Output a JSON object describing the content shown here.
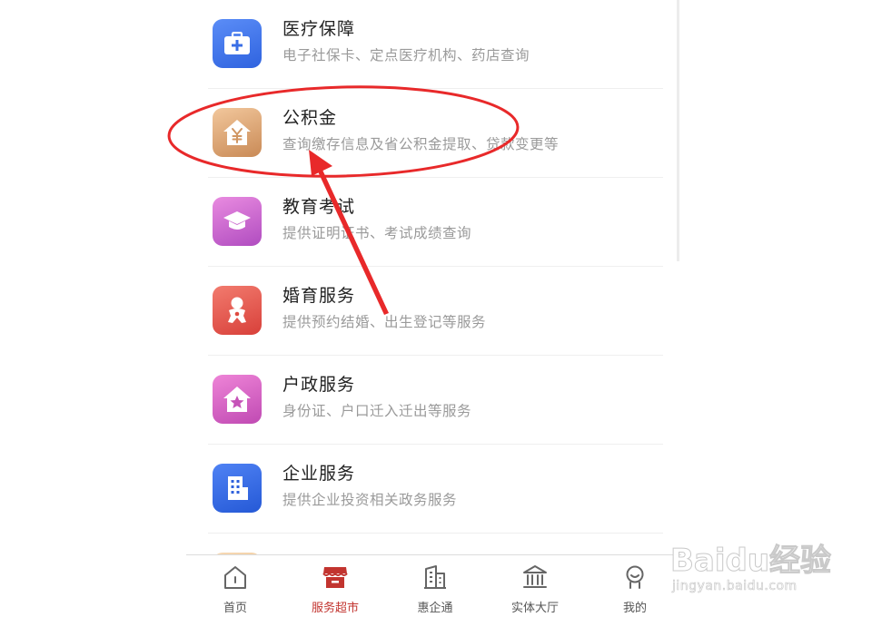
{
  "services": [
    {
      "title": "医疗保障",
      "desc": "电子社保卡、定点医疗机构、药店查询",
      "icon": "medical-kit-icon"
    },
    {
      "title": "公积金",
      "desc": "查询缴存信息及省公积金提取、贷款变更等",
      "icon": "housing-fund-icon"
    },
    {
      "title": "教育考试",
      "desc": "提供证明证书、考试成绩查询",
      "icon": "graduation-cap-icon"
    },
    {
      "title": "婚育服务",
      "desc": "提供预约结婚、出生登记等服务",
      "icon": "baby-icon"
    },
    {
      "title": "户政服务",
      "desc": "身份证、户口迁入迁出等服务",
      "icon": "star-house-icon"
    },
    {
      "title": "企业服务",
      "desc": "提供企业投资相关政务服务",
      "icon": "office-building-icon"
    },
    {
      "title": "",
      "desc": "",
      "icon": "partially-hidden-icon"
    }
  ],
  "tabbar": {
    "active": "服务超市",
    "items": [
      {
        "label": "首页",
        "icon": "home-icon"
      },
      {
        "label": "服务超市",
        "icon": "store-icon"
      },
      {
        "label": "惠企通",
        "icon": "building-icon"
      },
      {
        "label": "实体大厅",
        "icon": "government-hall-icon"
      },
      {
        "label": "我的",
        "icon": "user-icon"
      }
    ]
  },
  "colors": {
    "annotation_red": "#e8292a",
    "active_tab": "#c2342f"
  },
  "watermark": {
    "brand": "Baidu经验",
    "url": "jingyan.baidu.com"
  }
}
